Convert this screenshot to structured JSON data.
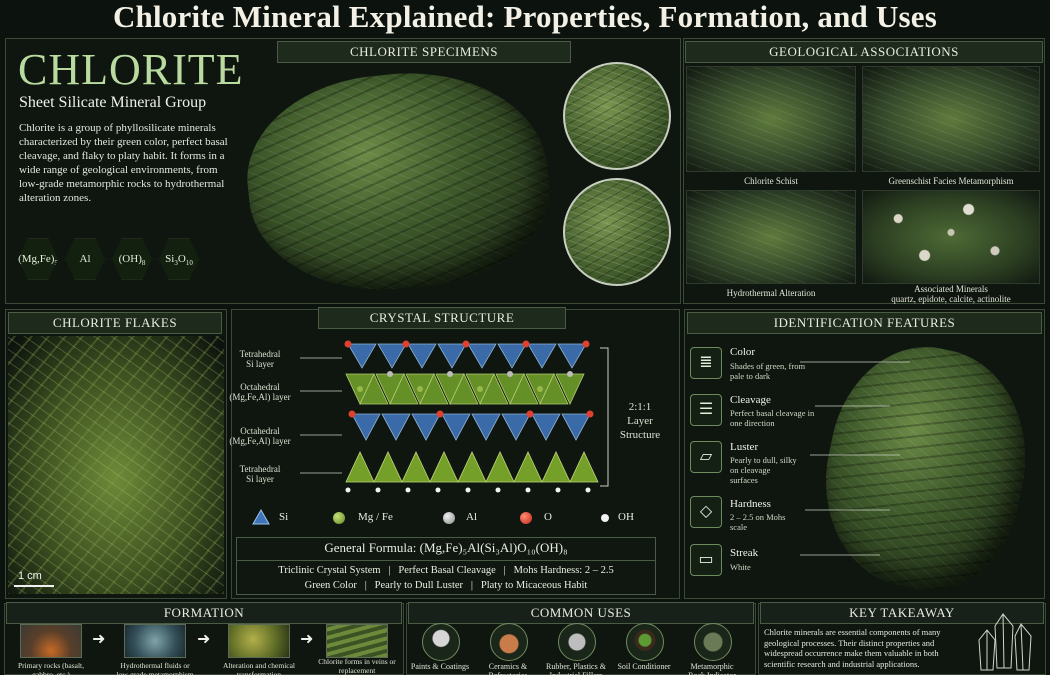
{
  "title": "Chlorite Mineral Explained: Properties, Formation, and Uses",
  "intro": {
    "name": "CHLORITE",
    "subtitle": "Sheet Silicate Mineral Group",
    "description": "Chlorite is a group of phyllosilicate minerals characterized by their green color, perfect basal cleavage, and flaky to platy habit. It forms in a wide range of geological environments, from low-grade metamorphic rocks to hydrothermal alteration zones.",
    "chem": [
      "(Mg,Fe)5",
      "Al",
      "(OH)8",
      "Si3O10"
    ]
  },
  "specimens": {
    "header": "CHLORITE SPECIMENS"
  },
  "geo": {
    "header": "GEOLOGICAL ASSOCIATIONS",
    "items": [
      {
        "label": "Chlorite Schist",
        "sub": ""
      },
      {
        "label": "Greenschist Facies Metamorphism",
        "sub": ""
      },
      {
        "label": "Hydrothermal Alteration",
        "sub": ""
      },
      {
        "label": "Associated Minerals",
        "sub": "quartz, epidote, calcite, actinolite"
      }
    ]
  },
  "flakes": {
    "header": "CHLORITE FLAKES",
    "scale": "1 cm"
  },
  "crystal": {
    "header": "CRYSTAL STRUCTURE",
    "layers": [
      "Tetrahedral\nSi layer",
      "Octahedral\n(Mg,Fe,Al) layer",
      "Octahedral\n(Mg,Fe,Al) layer",
      "Tetrahedral\nSi layer"
    ],
    "structure_label": "2:1:1\nLayer\nStructure",
    "legend": [
      "Si",
      "Mg / Fe",
      "Al",
      "O",
      "OH"
    ],
    "formula_label": "General Formula:",
    "formula": "(Mg,Fe)₅Al(Si₃Al)O₁₀(OH)₈",
    "props_line1": "Triclinic Crystal System   |   Perfect Basal Cleavage   |   Mohs Hardness: 2 – 2.5",
    "props_line2": "Green Color   |   Pearly to Dull Luster   |   Platy to Micaceous Habit"
  },
  "identification": {
    "header": "IDENTIFICATION FEATURES",
    "features": [
      {
        "icon": "layers-icon",
        "title": "Color",
        "desc": "Shades of green, from pale to dark"
      },
      {
        "icon": "cleavage-icon",
        "title": "Cleavage",
        "desc": "Perfect basal cleavage in one direction"
      },
      {
        "icon": "luster-icon",
        "title": "Luster",
        "desc": "Pearly to dull, silky on cleavage surfaces"
      },
      {
        "icon": "diamond-icon",
        "title": "Hardness",
        "desc": "2 – 2.5 on Mohs scale"
      },
      {
        "icon": "streak-icon",
        "title": "Streak",
        "desc": "White"
      }
    ]
  },
  "formation": {
    "header": "FORMATION",
    "steps": [
      "Primary rocks (basalt, gabbro, etc.)",
      "Hydrothermal fluids or low-grade metamorphism",
      "Alteration and chemical transformation",
      "Chlorite forms in veins or replacement"
    ]
  },
  "uses": {
    "header": "COMMON USES",
    "items": [
      "Paints & Coatings",
      "Ceramics & Refractories",
      "Rubber, Plastics & Industrial Fillers",
      "Soil Conditioner",
      "Metamorphic Rock Indicator"
    ]
  },
  "takeaway": {
    "header": "KEY TAKEAWAY",
    "text": "Chlorite minerals are essential components of many geological processes. Their distinct properties and widespread occurrence make them valuable in both scientific research and industrial applications."
  }
}
